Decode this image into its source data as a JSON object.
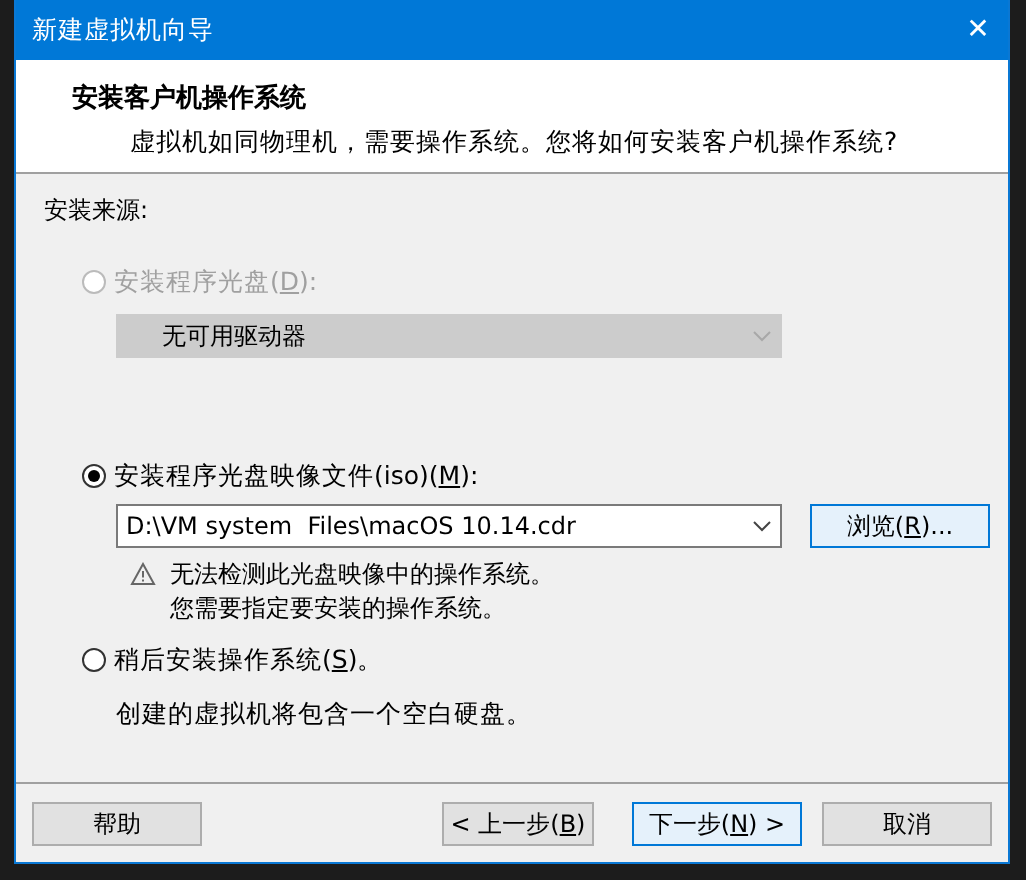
{
  "window": {
    "title": "新建虚拟机向导",
    "close": "✕"
  },
  "header": {
    "title": "安装客户机操作系统",
    "subtitle": "虚拟机如同物理机，需要操作系统。您将如何安装客户机操作系统?"
  },
  "section_label": "安装来源:",
  "options": [
    {
      "kind": "drive",
      "label_parts": [
        "安装程序光盘(",
        "D",
        "):"
      ],
      "selected": false,
      "disabled": true,
      "dropdown": {
        "value": "无可用驱动器",
        "disabled": true
      }
    },
    {
      "kind": "iso",
      "label_parts": [
        "安装程序光盘映像文件(iso)(",
        "M",
        "):"
      ],
      "selected": true,
      "disabled": false,
      "dropdown": {
        "value": "D:\\VM system  Files\\macOS 10.14.cdr",
        "disabled": false
      },
      "browse_parts": [
        "浏览(",
        "R",
        ")..."
      ],
      "warning": [
        "无法检测此光盘映像中的操作系统。",
        "您需要指定要安装的操作系统。"
      ]
    },
    {
      "kind": "later",
      "label_parts": [
        "稍后安装操作系统(",
        "S",
        ")。"
      ],
      "selected": false,
      "disabled": false,
      "note": "创建的虚拟机将包含一个空白硬盘。"
    }
  ],
  "buttons": [
    {
      "label_parts": [
        "帮助"
      ],
      "focused": false
    },
    {
      "label_parts": [
        "< 上一步(",
        "B",
        ")"
      ],
      "focused": false
    },
    {
      "label_parts": [
        "下一步(",
        "N",
        ") >"
      ],
      "focused": true
    },
    {
      "label_parts": [
        "取消"
      ],
      "focused": false
    }
  ]
}
